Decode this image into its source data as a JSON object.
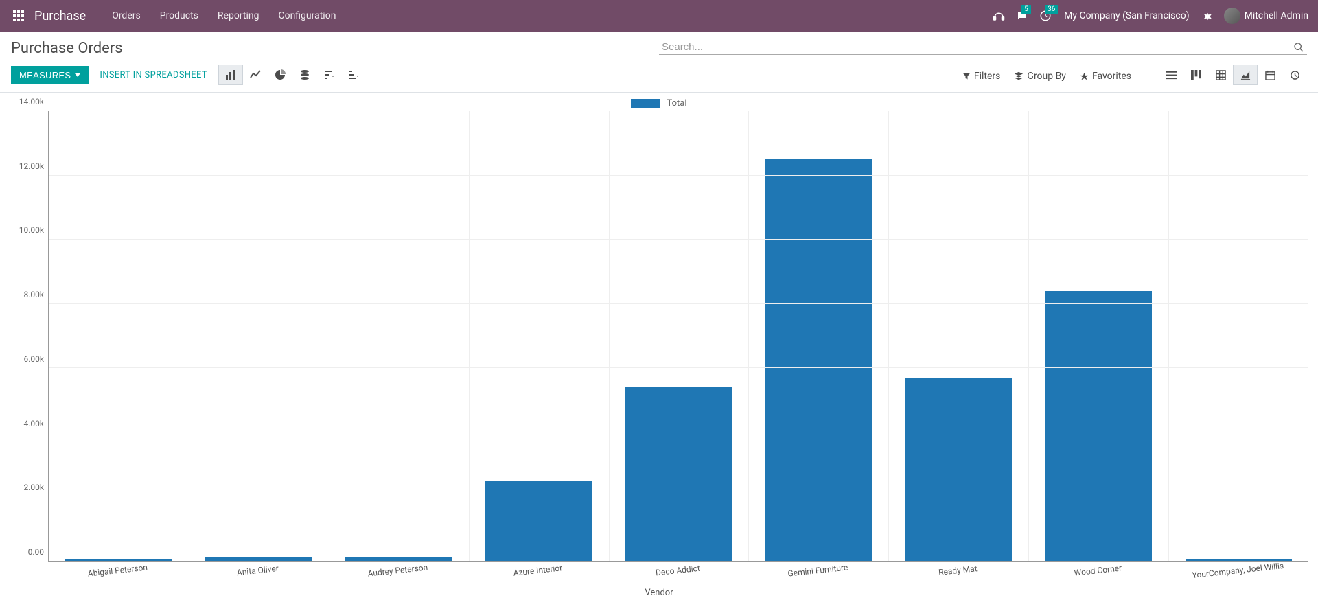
{
  "navbar": {
    "app_name": "Purchase",
    "menus": [
      "Orders",
      "Products",
      "Reporting",
      "Configuration"
    ],
    "messages_badge": "5",
    "activities_badge": "36",
    "company": "My Company (San Francisco)",
    "user_name": "Mitchell Admin"
  },
  "header": {
    "page_title": "Purchase Orders",
    "measures_label": "Measures",
    "spreadsheet_label": "Insert in Spreadsheet",
    "search_placeholder": "Search...",
    "filters_label": "Filters",
    "groupby_label": "Group By",
    "favorites_label": "Favorites"
  },
  "chart_data": {
    "type": "bar",
    "legend": "Total",
    "xlabel": "Vendor",
    "ylabel": "",
    "ylim": [
      0,
      14000
    ],
    "y_ticks": [
      "0.00",
      "2.00k",
      "4.00k",
      "6.00k",
      "8.00k",
      "10.00k",
      "12.00k",
      "14.00k"
    ],
    "categories": [
      "Abigail Peterson",
      "Anita Oliver",
      "Audrey Peterson",
      "Azure Interior",
      "Deco Addict",
      "Gemini Furniture",
      "Ready Mat",
      "Wood Corner",
      "YourCompany, Joel Willis"
    ],
    "values": [
      50,
      100,
      120,
      2500,
      5400,
      12500,
      5700,
      8400,
      70
    ]
  }
}
